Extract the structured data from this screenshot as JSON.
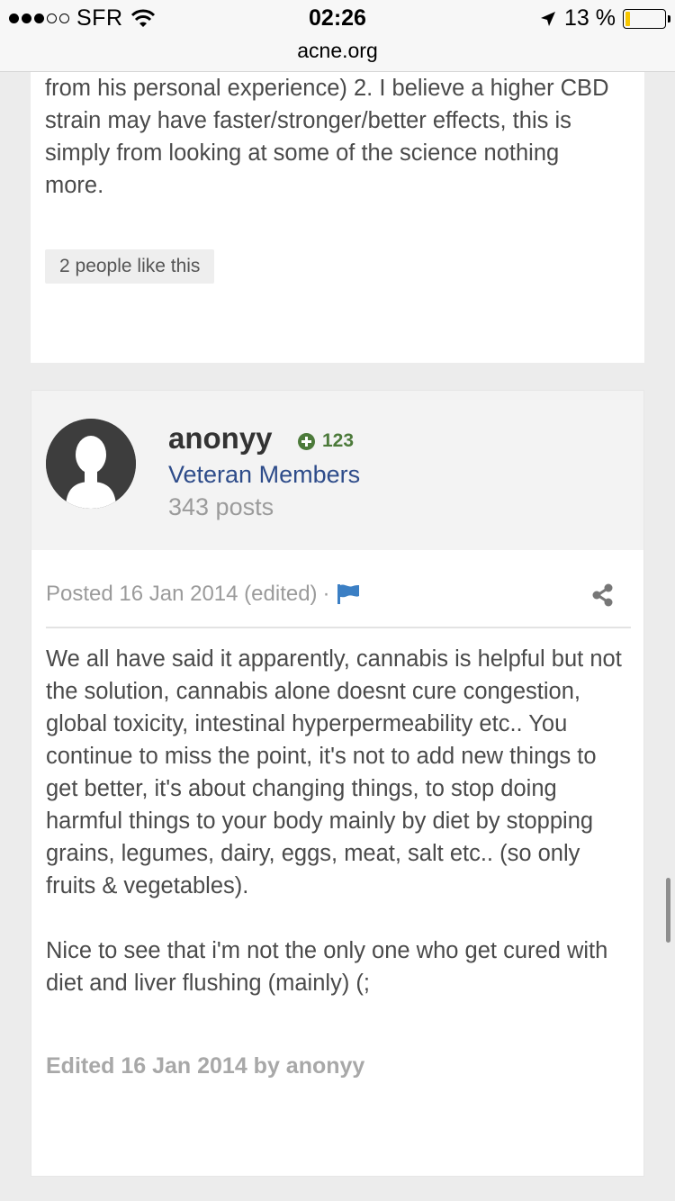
{
  "status_bar": {
    "carrier": "SFR",
    "time": "02:26",
    "battery": "13 %",
    "battery_level": 0.13,
    "battery_color": "#f7c600"
  },
  "url_bar": {
    "domain": "acne.org"
  },
  "previous_post": {
    "text": "from his personal experience) 2. I believe a higher CBD strain may have faster/stronger/better effects, this is simply from looking at some of the science nothing more.",
    "likes": "2 people like this"
  },
  "post": {
    "author": {
      "name": "anonyy",
      "reputation": "123",
      "group": "Veteran Members",
      "posts": "343 posts",
      "group_color": "#2e4c8a",
      "reputation_color": "#4c7a3a"
    },
    "meta": {
      "posted": "Posted 16 Jan 2014 (edited)",
      "separator": "·"
    },
    "paragraphs": [
      "We all have said it apparently, cannabis is helpful but not the solution, cannabis alone doesnt cure congestion, global toxicity, intestinal hyperpermeability etc.. You continue to miss the point, it's not to add new things to get better, it's about changing things, to stop doing harmful things to your body mainly by diet by stopping grains, legumes, dairy, eggs, meat, salt etc.. (so only fruits & vegetables).",
      "Nice to see that i'm not the only one who get cured with diet and liver flushing (mainly) (;"
    ],
    "edited_note": "Edited 16 Jan 2014 by anonyy"
  },
  "icons": {
    "signal": "signal-dots-icon",
    "wifi": "wifi-icon",
    "location": "location-arrow-icon",
    "battery": "battery-icon",
    "avatar": "default-avatar-icon",
    "reputation": "plus-circle-icon",
    "report": "flag-icon",
    "share": "share-icon"
  }
}
